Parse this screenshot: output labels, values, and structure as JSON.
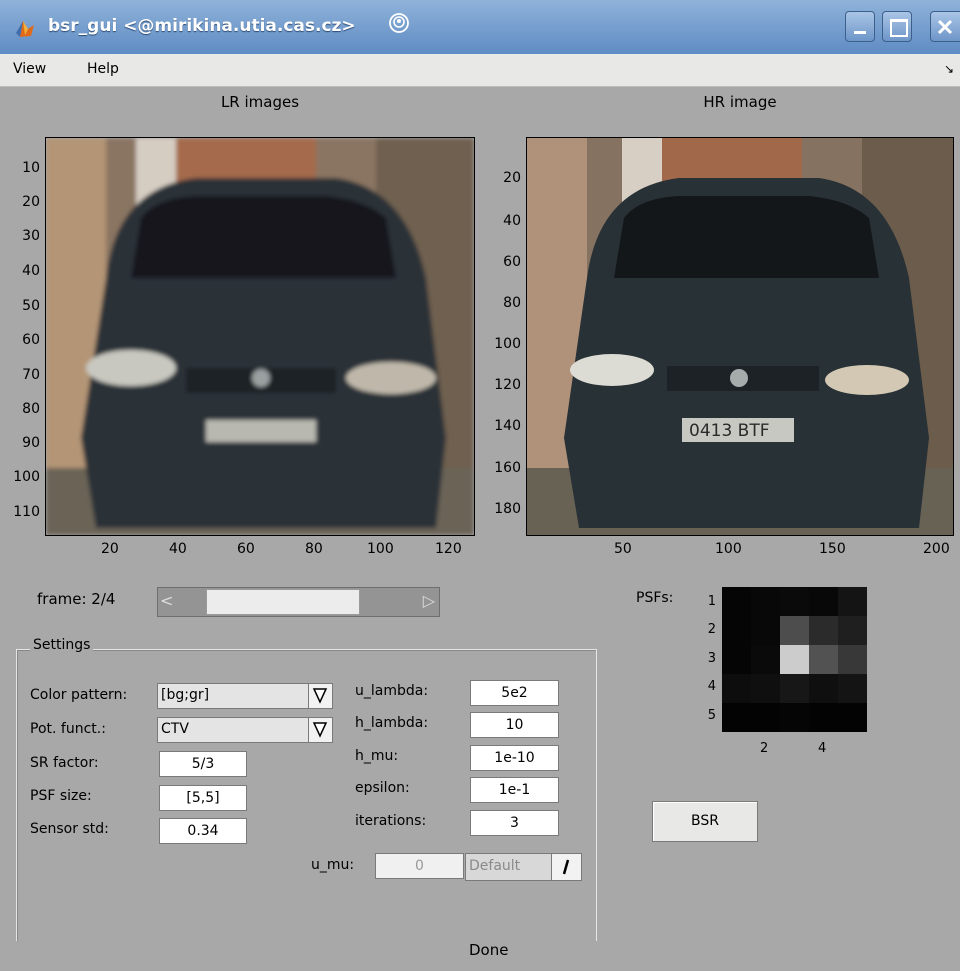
{
  "window": {
    "title": "bsr_gui <@mirikina.utia.cas.cz>"
  },
  "menu": {
    "items": [
      "View",
      "Help"
    ]
  },
  "lr_axes": {
    "title": "LR images",
    "y_ticks": [
      "10",
      "20",
      "30",
      "40",
      "50",
      "60",
      "70",
      "80",
      "90",
      "100",
      "110"
    ],
    "x_ticks": [
      "20",
      "40",
      "60",
      "80",
      "100",
      "120"
    ]
  },
  "hr_axes": {
    "title": "HR image",
    "y_ticks": [
      "20",
      "40",
      "60",
      "80",
      "100",
      "120",
      "140",
      "160",
      "180"
    ],
    "x_ticks": [
      "50",
      "100",
      "150",
      "200"
    ]
  },
  "frame": {
    "label": "frame: 2/4",
    "current": 2,
    "total": 4
  },
  "psf": {
    "label": "PSFs:",
    "y_ticks": [
      "1",
      "2",
      "3",
      "4",
      "5"
    ],
    "x_ticks": [
      "2",
      "4"
    ],
    "matrix": [
      [
        0.02,
        0.03,
        0.04,
        0.03,
        0.08
      ],
      [
        0.02,
        0.03,
        0.3,
        0.17,
        0.12
      ],
      [
        0.02,
        0.04,
        0.8,
        0.32,
        0.22
      ],
      [
        0.05,
        0.06,
        0.09,
        0.06,
        0.08
      ],
      [
        0.01,
        0.01,
        0.02,
        0.01,
        0.01
      ]
    ]
  },
  "settings": {
    "group_label": "Settings",
    "color_pattern": {
      "label": "Color pattern:",
      "value": "[bg;gr]"
    },
    "pot_funct": {
      "label": "Pot. funct.:",
      "value": "CTV"
    },
    "sr_factor": {
      "label": "SR factor:",
      "value": "5/3"
    },
    "psf_size": {
      "label": "PSF size:",
      "value": "[5,5]"
    },
    "sensor_std": {
      "label": "Sensor std:",
      "value": "0.34"
    },
    "u_lambda": {
      "label": "u_lambda:",
      "value": "5e2"
    },
    "h_lambda": {
      "label": "h_lambda:",
      "value": "10"
    },
    "h_mu": {
      "label": "h_mu:",
      "value": "1e-10"
    },
    "epsilon": {
      "label": "epsilon:",
      "value": "1e-1"
    },
    "iterations": {
      "label": "iterations:",
      "value": "3"
    },
    "u_mu": {
      "label": "u_mu:",
      "value": "0",
      "default_label": "Default"
    }
  },
  "bsr_button": "BSR",
  "status": "Done",
  "colors": {
    "titlebar": "#6f98cc",
    "background": "#a8a8a8",
    "menubar": "#e8e8e6"
  }
}
